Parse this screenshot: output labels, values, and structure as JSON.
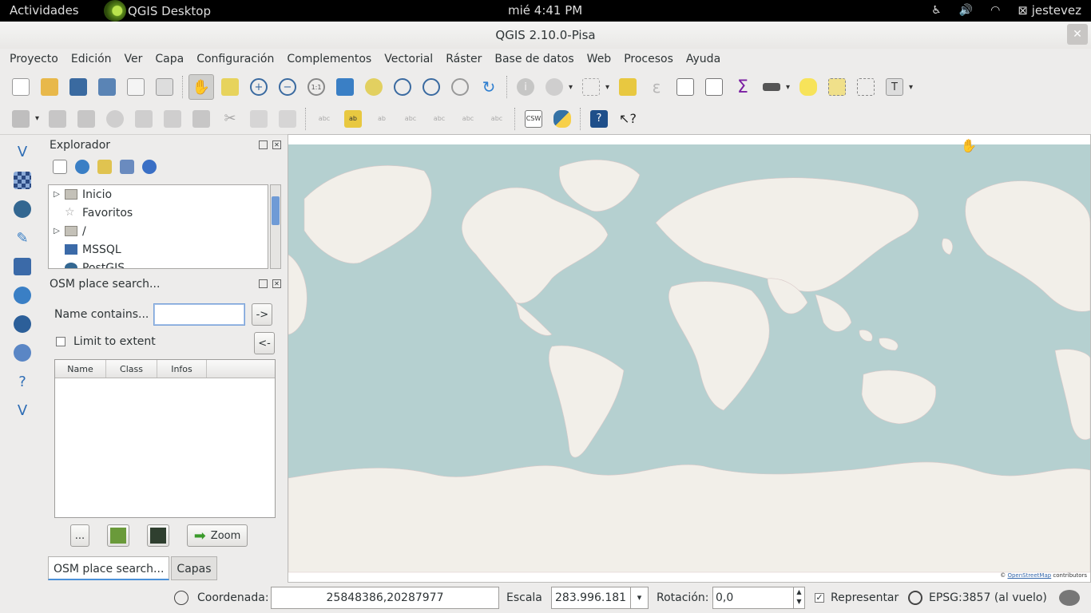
{
  "topbar": {
    "activities": "Actividades",
    "app_name": "QGIS Desktop",
    "clock": "mié  4:41 PM",
    "user": "jestevez"
  },
  "window": {
    "title": "QGIS 2.10.0-Pisa",
    "close_glyph": "✕"
  },
  "menu": [
    "Proyecto",
    "Edición",
    "Ver",
    "Capa",
    "Configuración",
    "Complementos",
    "Vectorial",
    "Ráster",
    "Base de datos",
    "Web",
    "Procesos",
    "Ayuda"
  ],
  "explorer": {
    "title": "Explorador",
    "items": [
      {
        "label": "Inicio",
        "icon": "folder-icon",
        "expandable": true
      },
      {
        "label": "Favoritos",
        "icon": "star-icon",
        "expandable": false
      },
      {
        "label": "/",
        "icon": "folder-icon",
        "expandable": true
      },
      {
        "label": "MSSQL",
        "icon": "mssql-icon",
        "expandable": false
      },
      {
        "label": "PostGIS",
        "icon": "postgis-icon",
        "expandable": false
      }
    ]
  },
  "osm": {
    "title": "OSM place search...",
    "name_label": "Name contains...",
    "name_value": "",
    "go_button": "->",
    "limit_label": "Limit to extent",
    "limit_checked": false,
    "back_button": "<-",
    "columns": [
      "Name",
      "Class",
      "Infos"
    ],
    "more_button": "...",
    "zoom_button": "Zoom"
  },
  "dock_tabs": [
    "OSM place search...",
    "Capas"
  ],
  "map": {
    "attribution_prefix": "© ",
    "attribution_link": "OpenStreetMap",
    "attribution_suffix": " contributors",
    "water_color": "#b5d0d0",
    "land_color": "#f2efe9"
  },
  "status": {
    "coord_label": "Coordenada:",
    "coord_value": "25848386,20287977",
    "scale_label": "Escala",
    "scale_value": "283.996.181",
    "rotation_label": "Rotación:",
    "rotation_value": "0,0",
    "render_label": "Representar",
    "render_checked": true,
    "crs_label": "EPSG:3857 (al vuelo)"
  }
}
